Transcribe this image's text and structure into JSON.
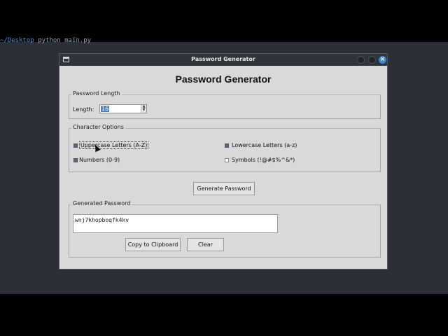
{
  "terminal": {
    "prompt": "~/Desktop",
    "command": "python main.py"
  },
  "window": {
    "title": "Password Generator"
  },
  "heading": "Password Generator",
  "length_group": {
    "label": "Password Length",
    "field_label": "Length:",
    "value": "16"
  },
  "options_group": {
    "label": "Character Options",
    "uppercase": {
      "label": "Uppercase Letters (A-Z)",
      "checked": true
    },
    "lowercase": {
      "label": "Lowercase Letters (a-z)",
      "checked": true
    },
    "numbers": {
      "label": "Numbers (0-9)",
      "checked": true
    },
    "symbols": {
      "label": "Symbols (!@#$%^&*)",
      "checked": false
    }
  },
  "generate_button": "Generate Password",
  "output_group": {
    "label": "Generated Password",
    "password": "wnj7khopboqfk4kv",
    "copy_button": "Copy to Clipboard",
    "clear_button": "Clear"
  },
  "colors": {
    "desktop": "#2b2f37",
    "window": "#d9d9d9",
    "titlebar": "#2f333a",
    "close_button": "#3d87d9",
    "selection": "#4f7ec0"
  }
}
